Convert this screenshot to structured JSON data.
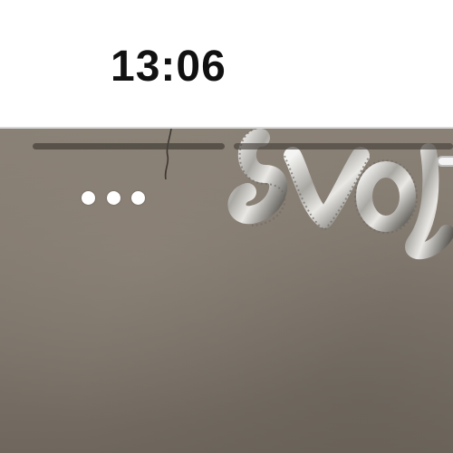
{
  "status_bar": {
    "time": "13:06"
  },
  "story": {
    "progress_segments": [
      {
        "state": "viewed",
        "fill": 1.0
      },
      {
        "state": "current",
        "fill": 1.0
      }
    ],
    "more_icon": "ellipsis-icon",
    "background_image": "silver-foil-letter-balloon-photo"
  },
  "colors": {
    "status_bar_bg": "#ffffff",
    "clock_text": "#111111",
    "photo_wall": "#847b71",
    "progress_bar": "#4c4741",
    "dots": "#ffffff"
  }
}
